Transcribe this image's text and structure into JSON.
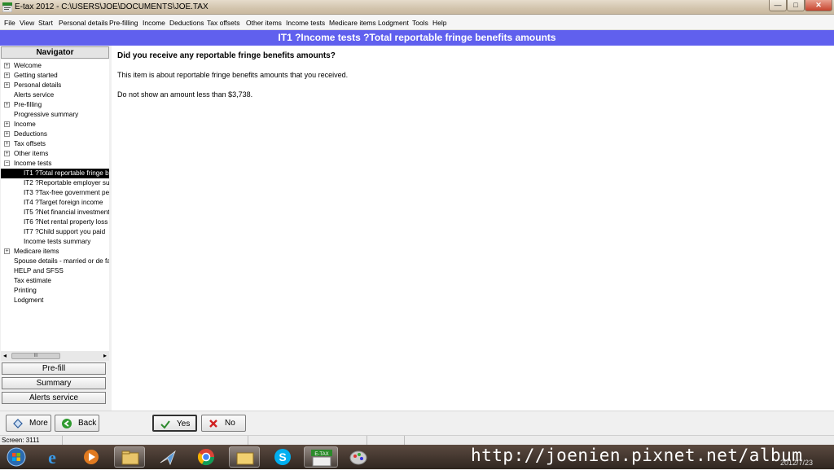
{
  "window": {
    "title": "E-tax 2012 - C:\\USERS\\JOE\\DOCUMENTS\\JOE.TAX",
    "controls": {
      "minimize": "—",
      "maximize": "□",
      "close": "✕"
    }
  },
  "menu": [
    "File",
    "View",
    "Start",
    "Personal details",
    "Pre-filling",
    "Income",
    "Deductions",
    "Tax offsets",
    "Other items",
    "Income tests",
    "Medicare items",
    "Lodgment",
    "Tools",
    "Help"
  ],
  "banner": "IT1 ?Income tests ?Total reportable fringe benefits amounts",
  "navigator": {
    "header": "Navigator",
    "items": [
      {
        "label": "Welcome",
        "expander": "+",
        "level": 0
      },
      {
        "label": "Getting started",
        "expander": "+",
        "level": 0
      },
      {
        "label": "Personal details",
        "expander": "+",
        "level": 0
      },
      {
        "label": "Alerts service",
        "expander": "",
        "level": 0
      },
      {
        "label": "Pre-filling",
        "expander": "+",
        "level": 0
      },
      {
        "label": "Progressive summary",
        "expander": "",
        "level": 0
      },
      {
        "label": "Income",
        "expander": "+",
        "level": 0
      },
      {
        "label": "Deductions",
        "expander": "+",
        "level": 0
      },
      {
        "label": "Tax offsets",
        "expander": "+",
        "level": 0
      },
      {
        "label": "Other items",
        "expander": "+",
        "level": 0
      },
      {
        "label": "Income tests",
        "expander": "−",
        "level": 0
      },
      {
        "label": "IT1 ?Total reportable fringe b",
        "expander": "",
        "level": 1,
        "selected": true
      },
      {
        "label": "IT2 ?Reportable employer sup",
        "expander": "",
        "level": 1
      },
      {
        "label": "IT3 ?Tax-free government pe",
        "expander": "",
        "level": 1
      },
      {
        "label": "IT4 ?Target foreign income",
        "expander": "",
        "level": 1
      },
      {
        "label": "IT5 ?Net financial investment",
        "expander": "",
        "level": 1
      },
      {
        "label": "IT6 ?Net rental property loss",
        "expander": "",
        "level": 1
      },
      {
        "label": "IT7 ?Child support you paid",
        "expander": "",
        "level": 1
      },
      {
        "label": "Income tests summary",
        "expander": "",
        "level": 1
      },
      {
        "label": "Medicare items",
        "expander": "+",
        "level": 0
      },
      {
        "label": "Spouse details - married or de fa",
        "expander": "",
        "level": 0
      },
      {
        "label": "HELP and SFSS",
        "expander": "",
        "level": 0
      },
      {
        "label": "Tax estimate",
        "expander": "",
        "level": 0
      },
      {
        "label": "Printing",
        "expander": "",
        "level": 0
      },
      {
        "label": "Lodgment",
        "expander": "",
        "level": 0
      }
    ],
    "scroll_thumb": "III",
    "buttons": {
      "prefill": "Pre-fill",
      "summary": "Summary",
      "alerts": "Alerts service"
    }
  },
  "content": {
    "question": "Did you receive any reportable fringe benefits amounts?",
    "para1": "This item is about reportable fringe benefits amounts that you received.",
    "para2": "Do not show an amount less than $3,738."
  },
  "footer": {
    "more": "More",
    "back": "Back",
    "yes": "Yes",
    "no": "No"
  },
  "status": {
    "screen": "Screen: 3111"
  },
  "taskbar": {
    "apps": [
      "start-orb",
      "internet-explorer",
      "media-player",
      "file-explorer",
      "app-plane",
      "chrome",
      "folder",
      "skype",
      "etax",
      "paint"
    ],
    "watermark": "http://joenien.pixnet.net/album",
    "date": "2012/7/23"
  },
  "colors": {
    "banner": "#6060ee",
    "selected": "#000000",
    "content_bg": "#ffffff"
  }
}
